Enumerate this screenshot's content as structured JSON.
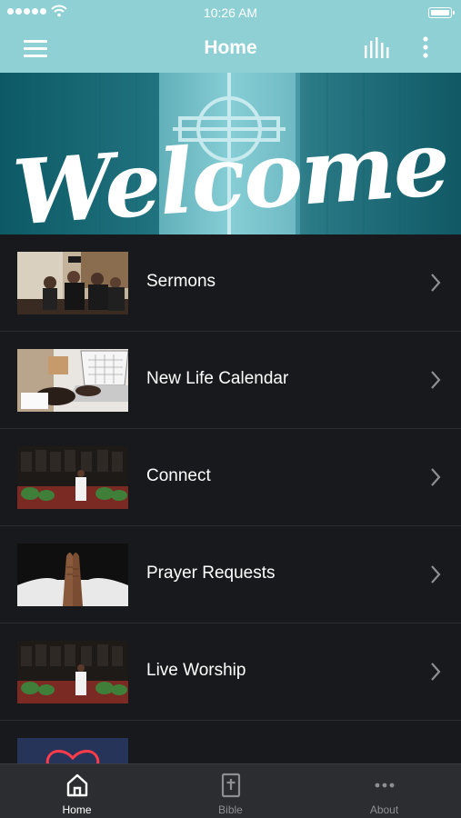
{
  "status_bar": {
    "time": "10:26 AM"
  },
  "nav": {
    "title": "Home"
  },
  "banner": {
    "text": "Welcome"
  },
  "menu_items": [
    {
      "label": "Sermons",
      "thumb": "sermons-photo"
    },
    {
      "label": "New Life Calendar",
      "thumb": "calendar-photo"
    },
    {
      "label": "Connect",
      "thumb": "choir-photo"
    },
    {
      "label": "Prayer Requests",
      "thumb": "praying-hands-photo"
    },
    {
      "label": "Live Worship",
      "thumb": "choir-photo"
    },
    {
      "label": "",
      "thumb": "neon-heart-photo"
    }
  ],
  "tabs": [
    {
      "label": "Home",
      "icon": "home-icon",
      "active": true
    },
    {
      "label": "Bible",
      "icon": "bible-icon",
      "active": false
    },
    {
      "label": "About",
      "icon": "more-dots-icon",
      "active": false
    }
  ],
  "colors": {
    "header": "#8fd0d4",
    "list_background": "#18191c",
    "tab_bar": "#2b2d30",
    "tab_active": "#ffffff",
    "tab_inactive": "#8e8f93"
  }
}
